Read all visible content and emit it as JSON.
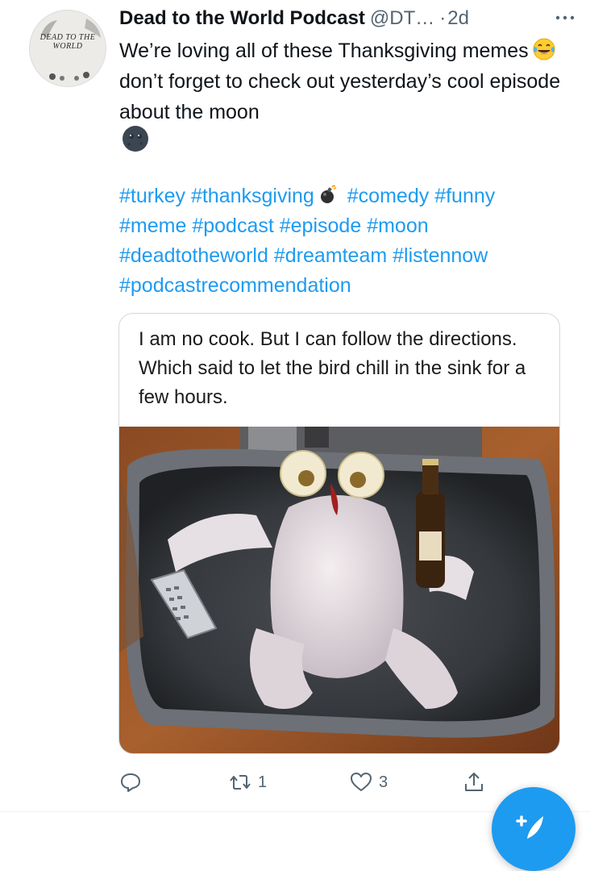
{
  "tweet": {
    "author_name": "Dead to the World Podcast",
    "handle": "@DT…",
    "dot": "·",
    "timestamp": "2d",
    "avatar_text": "DEAD TO THE WORLD",
    "text_part1": "We’re loving all of these Thanksgiving memes",
    "text_part2": "don’t forget to check out yesterday’s cool episode about the moon",
    "emoji_laugh": "face-with-tears-of-joy-icon",
    "emoji_moon": "new-moon-face-icon",
    "hashtags": [
      "#turkey",
      "#thanksgiving",
      "#comedy",
      "#funny",
      "#meme",
      "#podcast",
      "#episode",
      "#moon",
      "#deadtotheworld",
      "#dreamteam",
      "#listennow",
      "#podcastrecommendation"
    ],
    "media_caption": "I am no cook. But I can follow the directions. Which said to let the bird chill in the sink for a few hours."
  },
  "actions": {
    "reply_count": "",
    "retweet_count": "1",
    "like_count": "3"
  },
  "colors": {
    "link": "#1d9bf0",
    "secondary": "#536471",
    "text": "#0f1419"
  }
}
